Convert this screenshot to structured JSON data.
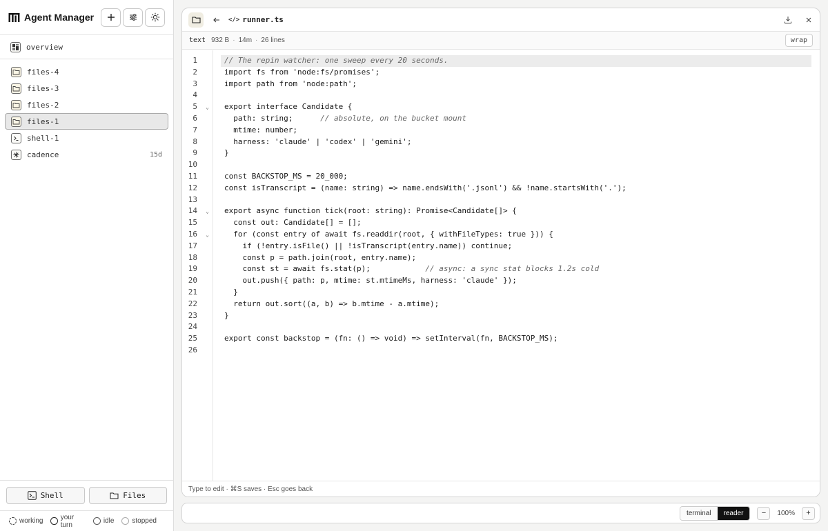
{
  "sidebar": {
    "title": "Agent Manager",
    "overview_label": "overview",
    "items": [
      {
        "label": "files-4",
        "kind": "files",
        "badge": ""
      },
      {
        "label": "files-3",
        "kind": "files",
        "badge": ""
      },
      {
        "label": "files-2",
        "kind": "files",
        "badge": ""
      },
      {
        "label": "files-1",
        "kind": "files",
        "badge": "",
        "selected": true
      },
      {
        "label": "shell-1",
        "kind": "shell",
        "badge": ""
      },
      {
        "label": "cadence",
        "kind": "cadence",
        "badge": "15d"
      }
    ],
    "shell_button": "Shell",
    "files_button": "Files",
    "legend": [
      "working",
      "your turn",
      "idle",
      "stopped"
    ]
  },
  "editor": {
    "filename": "runner.ts",
    "code_icon": "</>",
    "meta": {
      "type": "text",
      "size": "932 B",
      "age": "14m",
      "lines": "26 lines"
    },
    "wrap_label": "wrap",
    "status": "Type to edit · ⌘S saves · Esc goes back",
    "folded_lines": [
      5,
      14,
      16
    ],
    "code": [
      "// The repin watcher: one sweep every 20 seconds.",
      "import fs from 'node:fs/promises';",
      "import path from 'node:path';",
      "",
      "export interface Candidate {",
      "  path: string;      // absolute, on the bucket mount",
      "  mtime: number;",
      "  harness: 'claude' | 'codex' | 'gemini';",
      "}",
      "",
      "const BACKSTOP_MS = 20_000;",
      "const isTranscript = (name: string) => name.endsWith('.jsonl') && !name.startsWith('.');",
      "",
      "export async function tick(root: string): Promise<Candidate[]> {",
      "  const out: Candidate[] = [];",
      "  for (const entry of await fs.readdir(root, { withFileTypes: true })) {",
      "    if (!entry.isFile() || !isTranscript(entry.name)) continue;",
      "    const p = path.join(root, entry.name);",
      "    const st = await fs.stat(p);            // async: a sync stat blocks 1.2s cold",
      "    out.push({ path: p, mtime: st.mtimeMs, harness: 'claude' });",
      "  }",
      "  return out.sort((a, b) => b.mtime - a.mtime);",
      "}",
      "",
      "export const backstop = (fn: () => void) => setInterval(fn, BACKSTOP_MS);",
      ""
    ]
  },
  "bottombar": {
    "modes": [
      "terminal",
      "reader"
    ],
    "active_mode": "reader",
    "zoom_minus": "−",
    "zoom": "100%",
    "zoom_plus": "+"
  }
}
